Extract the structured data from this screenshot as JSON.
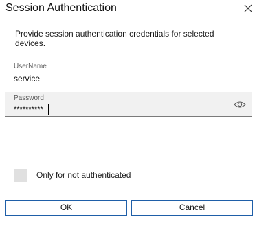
{
  "dialog": {
    "title": "Session Authentication",
    "description": "Provide session authentication credentials for selected devices."
  },
  "username": {
    "label": "UserName",
    "value": "service"
  },
  "password": {
    "label": "Password",
    "value": "**********",
    "reveal_icon": "eye-icon"
  },
  "options": {
    "only_not_authenticated_label": "Only for not authenticated",
    "only_not_authenticated_checked": false
  },
  "buttons": {
    "ok_label": "OK",
    "cancel_label": "Cancel"
  },
  "colors": {
    "button_border": "#1f5fa8",
    "password_bg": "#f1f1f1",
    "checkbox_bg": "#e0e0e0"
  }
}
